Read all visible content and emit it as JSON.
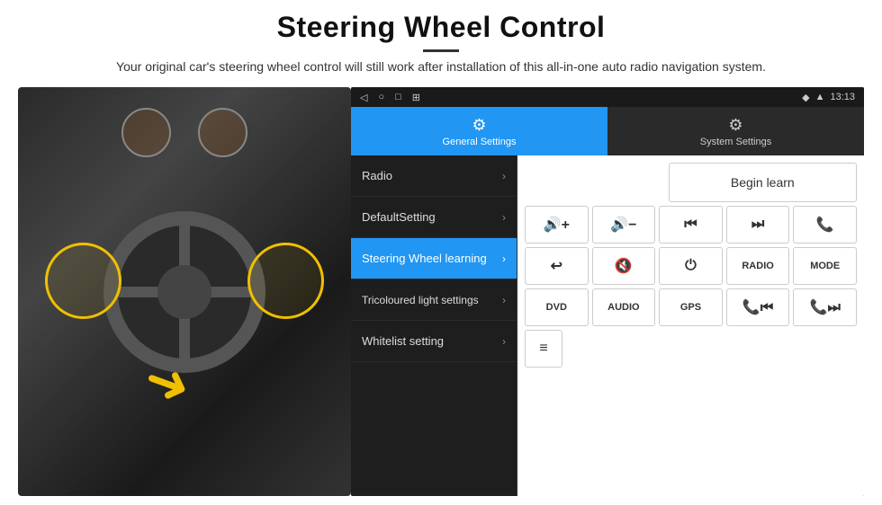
{
  "header": {
    "title": "Steering Wheel Control",
    "subtitle": "Your original car's steering wheel control will still work after installation of this all-in-one auto radio navigation system."
  },
  "device": {
    "status_bar": {
      "time": "13:13",
      "nav_icons": [
        "◁",
        "○",
        "□",
        "⊞"
      ],
      "right_icons": [
        "♦",
        "▲"
      ]
    },
    "tabs": [
      {
        "label": "General Settings",
        "icon": "⚙",
        "active": true
      },
      {
        "label": "System Settings",
        "icon": "🔧",
        "active": false
      }
    ],
    "menu_items": [
      {
        "label": "Radio",
        "active": false
      },
      {
        "label": "DefaultSetting",
        "active": false
      },
      {
        "label": "Steering Wheel learning",
        "active": true
      },
      {
        "label": "Tricoloured light settings",
        "active": false
      },
      {
        "label": "Whitelist setting",
        "active": false
      }
    ],
    "begin_learn_label": "Begin learn",
    "control_buttons": {
      "row1": [
        {
          "icon": "🔊+",
          "label": "vol-up"
        },
        {
          "icon": "🔊−",
          "label": "vol-down"
        },
        {
          "icon": "⏮",
          "label": "prev"
        },
        {
          "icon": "⏭",
          "label": "next"
        },
        {
          "icon": "📞",
          "label": "call"
        }
      ],
      "row2": [
        {
          "icon": "↩",
          "label": "back"
        },
        {
          "icon": "🔇",
          "label": "mute"
        },
        {
          "icon": "⏻",
          "label": "power"
        },
        {
          "text": "RADIO",
          "label": "radio"
        },
        {
          "text": "MODE",
          "label": "mode"
        }
      ],
      "row3": [
        {
          "text": "DVD",
          "label": "dvd"
        },
        {
          "text": "AUDIO",
          "label": "audio"
        },
        {
          "text": "GPS",
          "label": "gps"
        },
        {
          "icon": "📞⏮",
          "label": "call-prev"
        },
        {
          "icon": "📞⏭",
          "label": "call-next"
        }
      ]
    },
    "last_icon": "≡"
  }
}
